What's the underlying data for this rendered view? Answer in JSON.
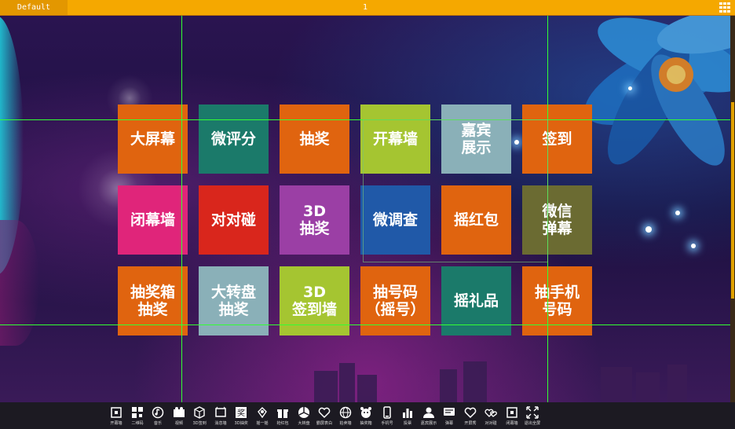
{
  "topbar": {
    "tab_label": "Default",
    "title": "1",
    "accent": "#f5a800",
    "grid_icon": "grid-icon"
  },
  "tiles": [
    {
      "label": "大屏幕",
      "color": "#e0640f"
    },
    {
      "label": "微评分",
      "color": "#1b7a6a"
    },
    {
      "label": "抽奖",
      "color": "#e0640f"
    },
    {
      "label": "开幕墙",
      "color": "#a5c531"
    },
    {
      "label": "嘉宾\n展示",
      "color": "#8ab0b8"
    },
    {
      "label": "签到",
      "color": "#e0640f"
    },
    {
      "label": "闭幕墙",
      "color": "#e0257a"
    },
    {
      "label": "对对碰",
      "color": "#d9261c"
    },
    {
      "label": "3D\n抽奖",
      "color": "#9b3fa5"
    },
    {
      "label": "微调查",
      "color": "#2059a8"
    },
    {
      "label": "摇红包",
      "color": "#e0640f"
    },
    {
      "label": "微信\n弹幕",
      "color": "#6b6b32"
    },
    {
      "label": "抽奖箱\n抽奖",
      "color": "#e0640f"
    },
    {
      "label": "大转盘\n抽奖",
      "color": "#8ab0b8"
    },
    {
      "label": "3D\n签到墙",
      "color": "#a5c531"
    },
    {
      "label": "抽号码\n（摇号）",
      "color": "#e0640f"
    },
    {
      "label": "摇礼品",
      "color": "#1b7a6a"
    },
    {
      "label": "抽手机\n号码",
      "color": "#e0640f"
    }
  ],
  "toolbar": {
    "items": [
      {
        "label": "开幕墙",
        "icon": "curtain-icon"
      },
      {
        "label": "二维码",
        "icon": "qrcode-icon"
      },
      {
        "label": "音乐",
        "icon": "music-icon"
      },
      {
        "label": "视频",
        "icon": "video-icon"
      },
      {
        "label": "3D签到",
        "icon": "cube-icon"
      },
      {
        "label": "消息墙",
        "icon": "wall-icon"
      },
      {
        "label": "3D抽奖",
        "icon": "prize-icon"
      },
      {
        "label": "摇一摇",
        "icon": "shake-icon"
      },
      {
        "label": "抢红包",
        "icon": "gift-icon"
      },
      {
        "label": "大转盘",
        "icon": "wheel-icon"
      },
      {
        "label": "霸屏表白",
        "icon": "heart-icon"
      },
      {
        "label": "拍卖墙",
        "icon": "globe-icon"
      },
      {
        "label": "抽奖箱",
        "icon": "alarm-icon"
      },
      {
        "label": "手机号",
        "icon": "phone-icon"
      },
      {
        "label": "投票",
        "icon": "chart-icon"
      },
      {
        "label": "嘉宾展示",
        "icon": "person-icon"
      },
      {
        "label": "弹幕",
        "icon": "barrage-icon"
      },
      {
        "label": "开屏秀",
        "icon": "heart-icon"
      },
      {
        "label": "对对碰",
        "icon": "hearts-icon"
      },
      {
        "label": "闭幕墙",
        "icon": "curtain-icon"
      },
      {
        "label": "退出全屏",
        "icon": "fullscreen-icon"
      }
    ]
  }
}
